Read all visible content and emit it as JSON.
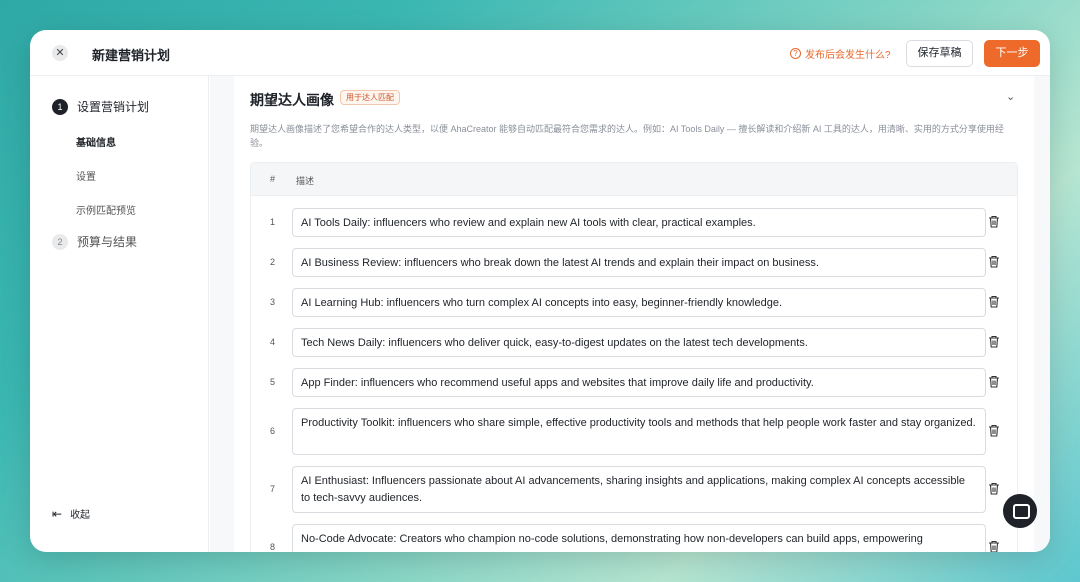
{
  "header": {
    "title": "新建营销计划",
    "help_link": "发布后会发生什么?",
    "save_draft": "保存草稿",
    "next": "下一步"
  },
  "sidebar": {
    "steps": [
      {
        "num": "1",
        "label": "设置营销计划",
        "active": true
      },
      {
        "num": "2",
        "label": "预算与结果",
        "active": false
      }
    ],
    "substeps": [
      "基础信息",
      "设置",
      "示例匹配预览"
    ],
    "collapse": "收起"
  },
  "section": {
    "title": "期望达人画像",
    "tag": "用于达人匹配",
    "description": "期望达人画像描述了您希望合作的达人类型，以便 AhaCreator 能够自动匹配最符合您需求的达人。例如：AI Tools Daily — 擅长解读和介绍新 AI 工具的达人，用清晰、实用的方式分享使用经验。",
    "table": {
      "col_num": "#",
      "col_desc": "描述",
      "rows": [
        {
          "num": "1",
          "text": "AI Tools Daily: influencers who review and explain new AI tools with clear, practical examples."
        },
        {
          "num": "2",
          "text": "AI Business Review: influencers who break down the latest AI trends and explain their impact on business."
        },
        {
          "num": "3",
          "text": "AI Learning Hub: influencers who turn complex AI concepts into easy, beginner-friendly knowledge."
        },
        {
          "num": "4",
          "text": "Tech News Daily: influencers who deliver quick, easy-to-digest updates on the latest tech developments."
        },
        {
          "num": "5",
          "text": "App Finder: influencers who recommend useful apps and websites that improve daily life and productivity."
        },
        {
          "num": "6",
          "text": "Productivity Toolkit: influencers who share simple, effective productivity tools and methods that help people work faster and stay organized."
        },
        {
          "num": "7",
          "text": "AI Enthusiast: Influencers passionate about AI advancements, sharing insights and applications, making complex AI concepts accessible to tech-savvy audiences."
        },
        {
          "num": "8",
          "text": "No-Code Advocate: Creators who champion no-code solutions, demonstrating how non-developers can build apps, empowering"
        }
      ]
    }
  },
  "icons": {
    "close": "close-icon",
    "help": "question-circle-icon",
    "chevron": "chevron-down-icon",
    "delete": "trash-icon",
    "collapse": "collapse-left-icon",
    "chat": "chat-icon"
  },
  "colors": {
    "accent": "#ee6a2a",
    "tag_bg": "#fff5ef",
    "tag_border": "#f1c7ad"
  }
}
